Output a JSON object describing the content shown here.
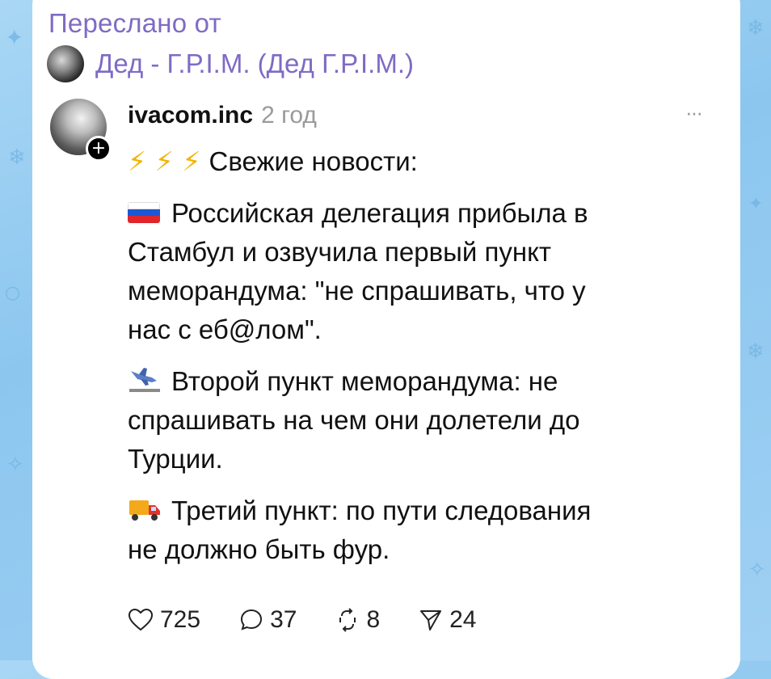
{
  "forward": {
    "label": "Переслано от",
    "source_name": "Дед - Г.Р.I.М. (Дед Г.Р.I.М.)"
  },
  "post": {
    "username": "ivacom.inc",
    "time": "2 год",
    "more_label": "···",
    "avatar_plus": "+",
    "paragraphs": {
      "p1": {
        "prefix": "⚡ ⚡ ⚡",
        "line1": "Свежие новости:"
      },
      "p2": {
        "line1": "Российская делегация прибыла в",
        "line2": "Стамбул и озвучила первый пункт",
        "line3": "меморандума: \"не спрашивать, что у",
        "line4": "нас с еб@лом\"."
      },
      "p3": {
        "line1": "Второй пункт меморандума: не",
        "line2": "спрашивать на чем они долетели до",
        "line3": "Турции."
      },
      "p4": {
        "line1": "Третий пункт: по пути следования",
        "line2": "не должно быть фур."
      }
    },
    "actions": {
      "likes": "725",
      "comments": "37",
      "reposts": "8",
      "shares": "24"
    }
  },
  "colors": {
    "accent": "#7f6bc4",
    "background": "#9fd0f3",
    "bolt": "#f1b400"
  }
}
